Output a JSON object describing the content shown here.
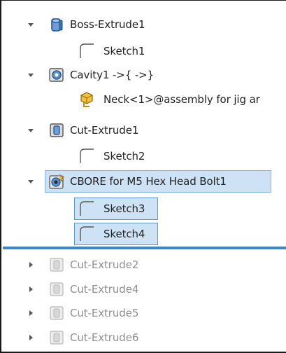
{
  "tree": {
    "items": [
      {
        "label": "Boss-Extrude1"
      },
      {
        "label": "Sketch1"
      },
      {
        "label": "Cavity1 ->{ ->}"
      },
      {
        "label": "Neck<1>@assembly for jig ar"
      },
      {
        "label": "Cut-Extrude1"
      },
      {
        "label": "Sketch2"
      },
      {
        "label": "CBORE for M5 Hex Head Bolt1"
      },
      {
        "label": "Sketch3"
      },
      {
        "label": "Sketch4"
      },
      {
        "label": "Cut-Extrude2"
      },
      {
        "label": "Cut-Extrude4"
      },
      {
        "label": "Cut-Extrude5"
      },
      {
        "label": "Cut-Extrude6"
      }
    ]
  },
  "colors": {
    "selection_fill": "#cde3f5",
    "selection_border": "#7eb4de",
    "rollback_bar": "#3f86c4",
    "suppressed_text": "#8f8f8f"
  }
}
